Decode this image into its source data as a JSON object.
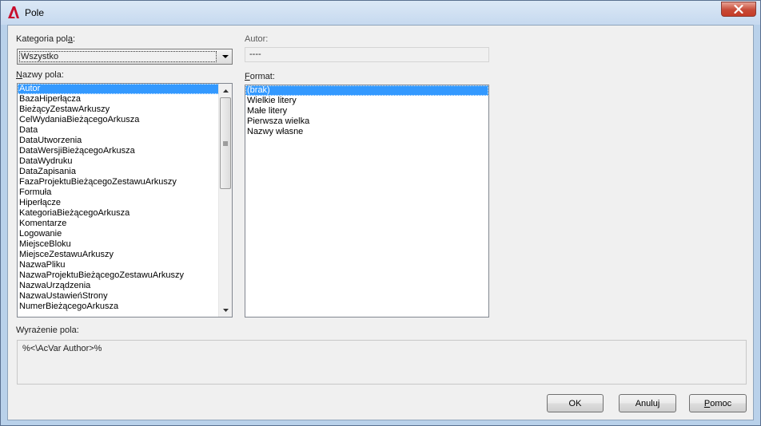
{
  "window": {
    "title": "Pole",
    "close_glyph": "✕"
  },
  "category": {
    "label": "Kategoria pola:",
    "selected": "Wszystko"
  },
  "field_names": {
    "label": "Nazwy pola:",
    "items": [
      "Autor",
      "BazaHiperłącza",
      "BieżącyZestawArkuszy",
      "CelWydaniaBieżącegoArkusza",
      "Data",
      "DataUtworzenia",
      "DataWersjiBieżącegoArkusza",
      "DataWydruku",
      "DataZapisania",
      "FazaProjektuBieżącegoZestawuArkuszy",
      "Formuła",
      "Hiperłącze",
      "KategoriaBieżącegoArkusza",
      "Komentarze",
      "Logowanie",
      "MiejsceBloku",
      "MiejsceZestawuArkuszy",
      "NazwaPliku",
      "NazwaProjektuBieżącegoZestawuArkuszy",
      "NazwaUrządzenia",
      "NazwaUstawieńStrony",
      "NumerBieżącegoArkusza"
    ],
    "selected_index": 0
  },
  "author": {
    "label": "Autor:",
    "value": "----"
  },
  "format": {
    "label": "Format:",
    "items": [
      "(brak)",
      "Wielkie litery",
      "Małe litery",
      "Pierwsza wielka",
      "Nazwy własne"
    ],
    "selected_index": 0
  },
  "expression": {
    "label": "Wyrażenie pola:",
    "value": "%<\\AcVar Author>%"
  },
  "buttons": {
    "ok": "OK",
    "cancel": "Anuluj",
    "help": "Pomoc"
  }
}
